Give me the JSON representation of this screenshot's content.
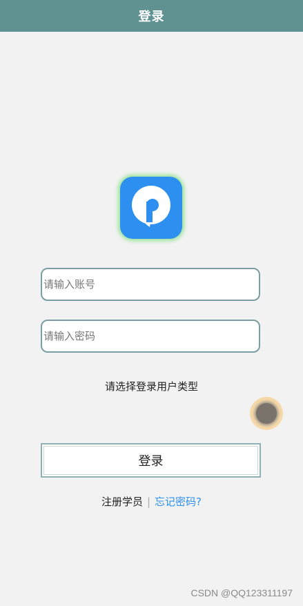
{
  "header": {
    "title": "登录"
  },
  "form": {
    "account_placeholder": "请输入账号",
    "password_placeholder": "请输入密码",
    "user_type_prompt": "请选择登录用户类型",
    "login_label": "登录"
  },
  "links": {
    "register": "注册学员",
    "separator": "|",
    "forgot": "忘记密码?"
  },
  "watermark": "CSDN @QQ123311197",
  "colors": {
    "header_bg": "#5f9291",
    "logo_bg": "#2d8ff0",
    "link_blue": "#2d8ff0",
    "input_border": "#7a9ea3"
  },
  "icons": {
    "logo": "map-pin-p-icon",
    "float": "floating-ball-icon"
  }
}
